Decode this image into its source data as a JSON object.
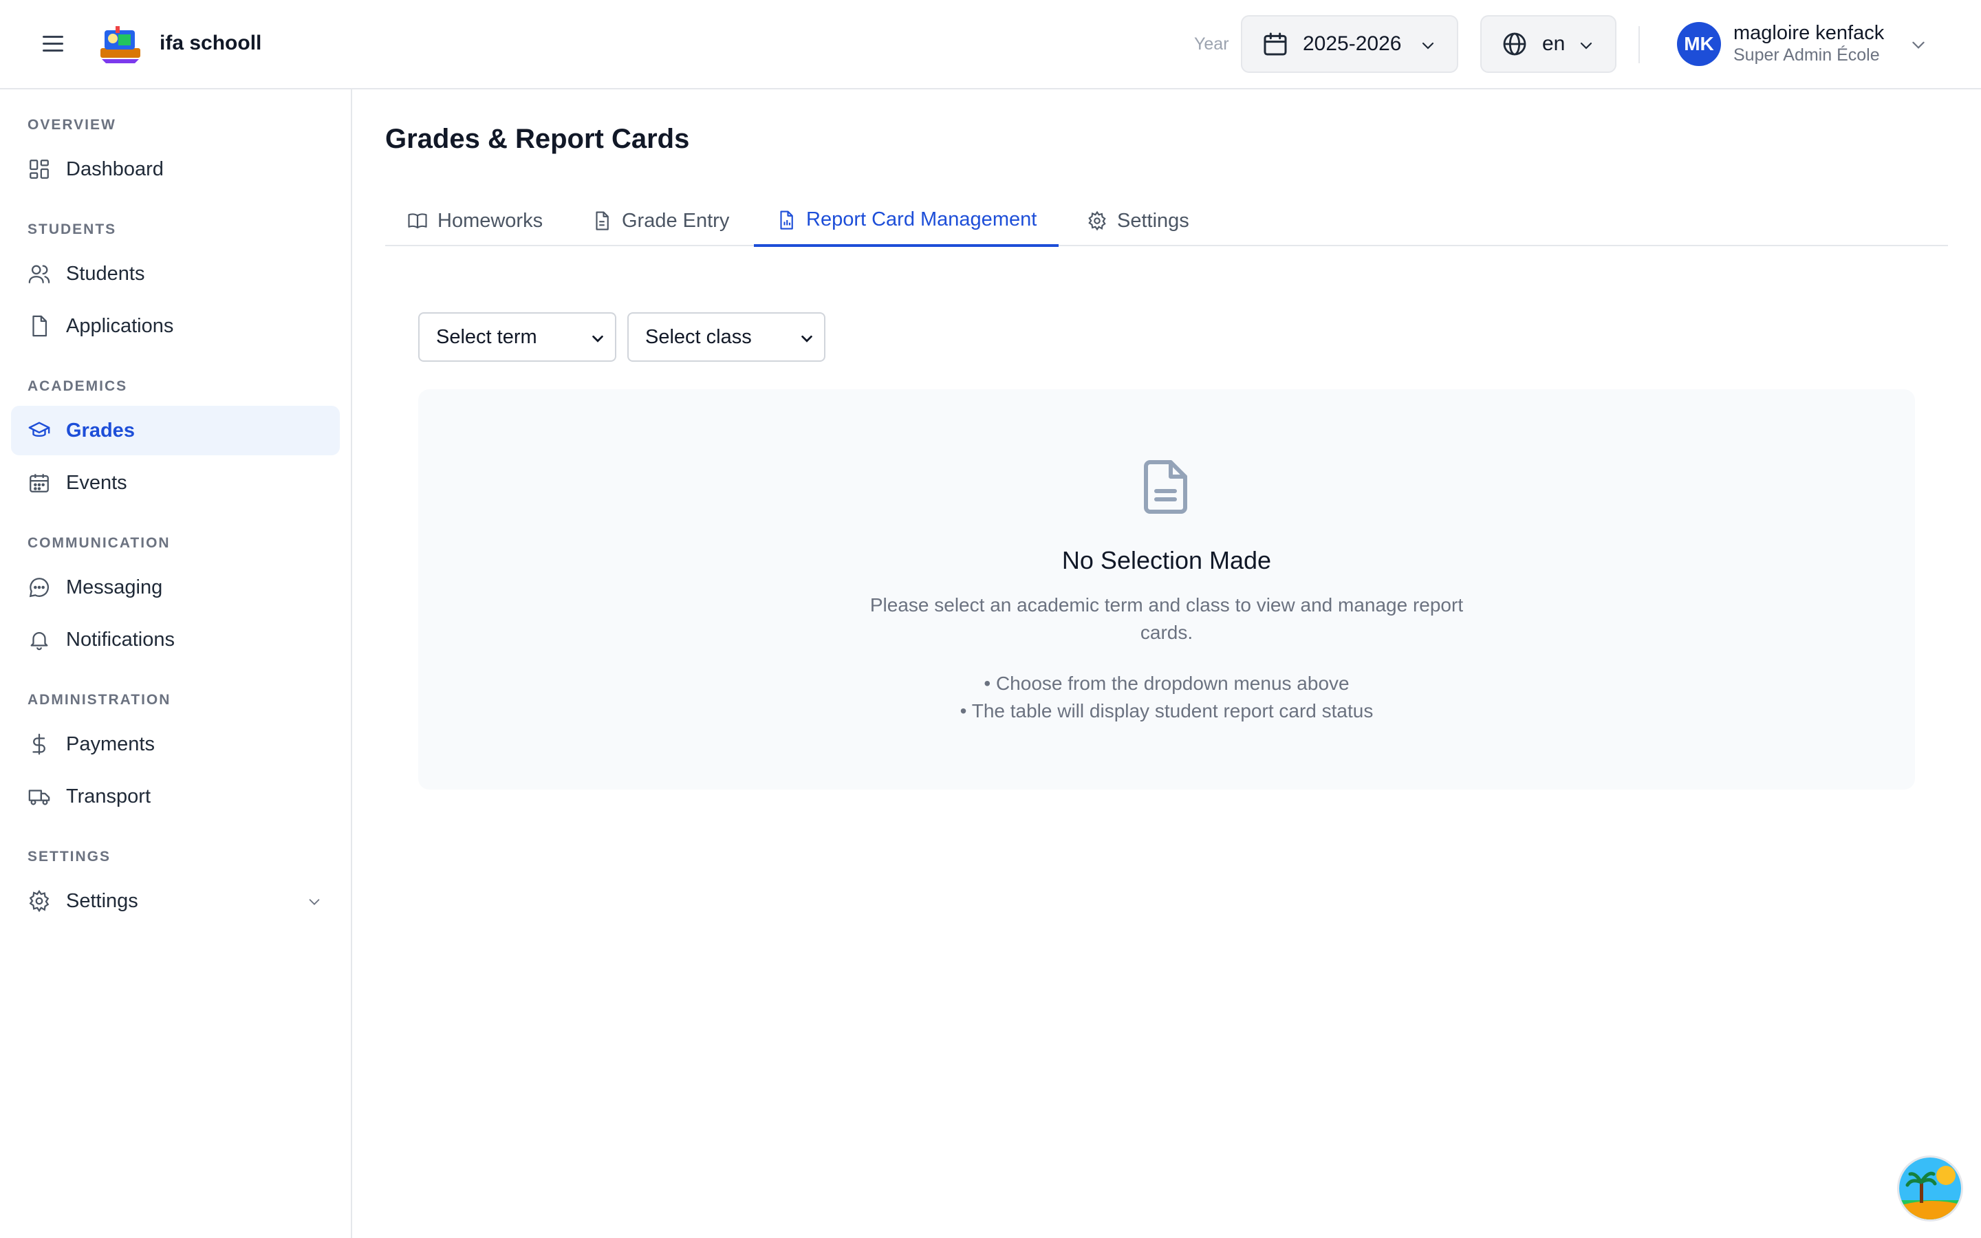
{
  "header": {
    "brand": "ifa schooll",
    "year_label": "Year",
    "year_value": "2025-2026",
    "language_value": "en",
    "user": {
      "initials": "MK",
      "name": "magloire kenfack",
      "role": "Super Admin École"
    }
  },
  "sidebar": {
    "sections": [
      {
        "title": "OVERVIEW",
        "items": [
          {
            "label": "Dashboard",
            "icon": "dashboard-icon"
          }
        ]
      },
      {
        "title": "STUDENTS",
        "items": [
          {
            "label": "Students",
            "icon": "users-icon"
          },
          {
            "label": "Applications",
            "icon": "file-icon"
          }
        ]
      },
      {
        "title": "ACADEMICS",
        "items": [
          {
            "label": "Grades",
            "icon": "graduation-cap-icon"
          },
          {
            "label": "Events",
            "icon": "calendar-icon"
          }
        ]
      },
      {
        "title": "COMMUNICATION",
        "items": [
          {
            "label": "Messaging",
            "icon": "message-icon"
          },
          {
            "label": "Notifications",
            "icon": "bell-icon"
          }
        ]
      },
      {
        "title": "ADMINISTRATION",
        "items": [
          {
            "label": "Payments",
            "icon": "dollar-icon"
          },
          {
            "label": "Transport",
            "icon": "truck-icon"
          }
        ]
      },
      {
        "title": "SETTINGS",
        "items": [
          {
            "label": "Settings",
            "icon": "gear-icon"
          }
        ]
      }
    ],
    "active_item": "Grades"
  },
  "main": {
    "title": "Grades & Report Cards",
    "tabs": [
      {
        "label": "Homeworks",
        "icon": "book-icon"
      },
      {
        "label": "Grade Entry",
        "icon": "document-icon"
      },
      {
        "label": "Report Card Management",
        "icon": "report-icon"
      },
      {
        "label": "Settings",
        "icon": "gear-icon"
      }
    ],
    "active_tab": "Report Card Management",
    "filters": {
      "term": "Select term",
      "class": "Select class"
    },
    "empty_state": {
      "title": "No Selection Made",
      "description": "Please select an academic term and class to view and manage report cards.",
      "hints": [
        "• Choose from the dropdown menus above",
        "• The table will display student report card status"
      ]
    }
  },
  "colors": {
    "accent": "#1d4ed8",
    "active_bg": "#eef4fd",
    "muted_text": "#6b7280"
  }
}
